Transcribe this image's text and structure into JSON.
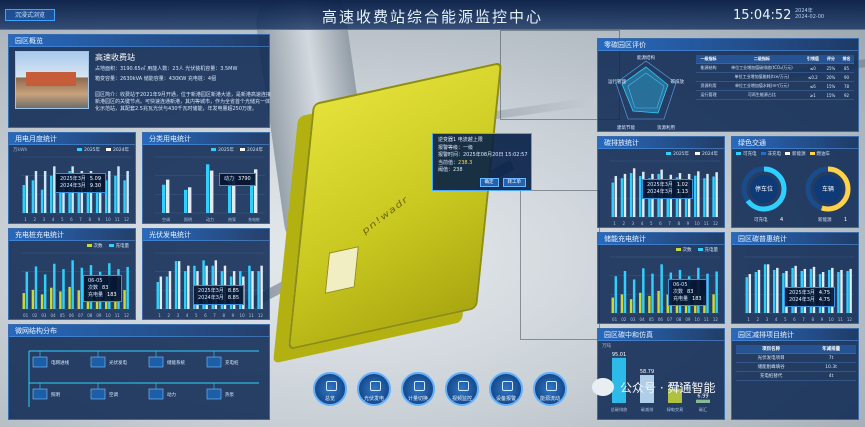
{
  "header": {
    "title": "高速收费站综合能源监控中心",
    "mode_button": "沉浸式浏览",
    "clock": "15:04:52",
    "date_line1": "2024年",
    "date_line2": "2024-02-00"
  },
  "overview": {
    "title": "园区概览",
    "name": "高速收费站",
    "rows": [
      "占地面积：3190.65㎡  用能人数：23人      光伏装机容量：3.5MW",
      "箱变容量：2630kVA  储能容量：430KW      充电桩：4個"
    ],
    "description": "园区简介：收费站于2021年9月开通，位于新港园区新港大道，是新港高速连接新港园区的关键节点。可快速连通新港，其内等城市，作为全省首个光储充一体化示范站，其配套2.5兆瓦光伏与430千瓦时储能，年发电量超250万度。"
  },
  "monthly_power": {
    "title": "用电月度统计",
    "unit": "万kWh",
    "legend": [
      "2025年",
      "2024年"
    ],
    "tooltip": {
      "a_label": "2025年3月",
      "a_val": "5.09",
      "b_label": "2024年3月",
      "b_val": "9.30"
    },
    "chart_data": {
      "type": "bar",
      "categories": [
        "1",
        "2",
        "3",
        "4",
        "5",
        "6",
        "7",
        "8",
        "9",
        "10",
        "11",
        "12"
      ],
      "series": [
        {
          "name": "2025年",
          "values": [
            6,
            7,
            5,
            8,
            6,
            9,
            7,
            8,
            6,
            7,
            8,
            7
          ]
        },
        {
          "name": "2024年",
          "values": [
            8,
            9,
            9,
            10,
            8,
            10,
            9,
            9,
            8,
            9,
            10,
            9
          ]
        }
      ],
      "ylim": [
        0,
        12
      ]
    }
  },
  "category_power": {
    "title": "分类用电统计",
    "legend": [
      "2025年",
      "2024年"
    ],
    "tooltip": {
      "label": "动力",
      "val": "3790"
    },
    "chart_data": {
      "type": "bar",
      "categories": [
        "空调",
        "照明",
        "动力",
        "热泵",
        "充电桩"
      ],
      "series": [
        {
          "name": "2025年",
          "values": [
            2200,
            1800,
            3790,
            2600,
            3000
          ]
        },
        {
          "name": "2024年",
          "values": [
            2600,
            2000,
            3300,
            2900,
            3400
          ]
        }
      ]
    }
  },
  "charger_stats": {
    "title": "充电桩充电统计",
    "legend": [
      "次数",
      "充电量"
    ],
    "tooltip": {
      "title": "06-05",
      "a_label": "次数",
      "a_val": "83",
      "b_label": "充电量",
      "b_val": "183"
    },
    "chart_data": {
      "type": "bar",
      "categories": [
        "01",
        "02",
        "03",
        "04",
        "05",
        "06",
        "07",
        "08",
        "09",
        "10",
        "11",
        "12"
      ],
      "series": [
        {
          "name": "次数",
          "values": [
            60,
            72,
            55,
            80,
            66,
            83,
            70,
            74,
            62,
            78,
            68,
            71
          ]
        },
        {
          "name": "充电量",
          "values": [
            140,
            160,
            130,
            170,
            150,
            183,
            155,
            165,
            140,
            172,
            150,
            158
          ]
        }
      ]
    }
  },
  "pv_stats": {
    "title": "光伏发电统计",
    "tooltip": {
      "a_label": "2025年3月",
      "a_val": "8.85",
      "b_label": "2024年3月",
      "b_val": "8.85"
    },
    "chart_data": {
      "type": "bar",
      "categories": [
        "1",
        "2",
        "3",
        "4",
        "5",
        "6",
        "7",
        "8",
        "9",
        "10",
        "11",
        "12"
      ],
      "series": [
        {
          "name": "2025年",
          "values": [
            5,
            6,
            8.85,
            7,
            8,
            9,
            8,
            7,
            6,
            7,
            8,
            7
          ]
        },
        {
          "name": "2024年",
          "values": [
            6,
            7,
            8.85,
            8,
            7,
            8,
            9,
            8,
            7,
            6,
            7,
            8
          ]
        }
      ]
    }
  },
  "microgrid": {
    "title": "微网结构分布",
    "labels": [
      "电网进线",
      "光伏发电",
      "储能系统",
      "充电桩",
      "照明",
      "空调",
      "动力",
      "热泵"
    ]
  },
  "popup": {
    "line1": "逆变器1 电流越上限",
    "line2": "报警等级：一级",
    "line3": "报警时间：2025年08月20日 15:02:57",
    "line4": "当前值：",
    "value": "238.3",
    "line5": "阈值：238",
    "btn_confirm": "确定",
    "btn_ticket": "转工单"
  },
  "nav": [
    "总览",
    "光伏发电",
    "计量切换",
    "视频监控",
    "设备报警",
    "能源流动"
  ],
  "carbon_eval": {
    "title": "零碳园区评价",
    "radar_labels": [
      "能源结构",
      "碳排放",
      "资源利用",
      "运行管理",
      "建筑节能"
    ],
    "table_headers": [
      "一级指标",
      "二级指标",
      "引领值",
      "评分",
      "排名"
    ],
    "table_rows": [
      [
        "能源结构",
        "单位工业增加值碳排放(tCO₂/万元)",
        "≤0",
        "25%",
        "85"
      ],
      [
        "",
        "单位工业增加值能耗(tce/万元)",
        "≤0.2",
        "20%",
        "90"
      ],
      [
        "资源利用",
        "单位工业增加值水耗(m³/万元)",
        "≤6",
        "15%",
        "78"
      ],
      [
        "运行管理",
        "可再生能源占比",
        "≥1",
        "15%",
        "92"
      ]
    ]
  },
  "carbon_emission": {
    "title": "碳排放统计",
    "legend": [
      "2025年",
      "2024年"
    ],
    "tooltip": {
      "a_label": "2025年3月",
      "a_val": "1.02",
      "b_label": "2024年3月",
      "b_val": "1.13"
    },
    "chart_data": {
      "type": "bar",
      "categories": [
        "1",
        "2",
        "3",
        "4",
        "5",
        "6",
        "7",
        "8",
        "9",
        "10",
        "11",
        "12"
      ],
      "series": [
        {
          "name": "2025年",
          "values": [
            0.8,
            0.9,
            1.02,
            0.95,
            0.9,
            1.0,
            0.85,
            0.92,
            0.88,
            0.96,
            0.9,
            0.94
          ]
        },
        {
          "name": "2024年",
          "values": [
            0.95,
            1.0,
            1.13,
            1.05,
            1.0,
            1.1,
            0.98,
            1.02,
            1.0,
            1.06,
            1.0,
            1.04
          ]
        }
      ]
    }
  },
  "green_transport": {
    "title": "绿色交通",
    "legend": [
      "可充电",
      "非充电",
      "新能源",
      "燃油车"
    ],
    "gauge1_label": "停车位",
    "gauge2_label": "车辆",
    "gauge1_foot": "可充电",
    "gauge1_val": "4",
    "gauge2_foot": "新能源",
    "gauge2_val": "1",
    "gauge1_frac": 0.65,
    "gauge2_frac": 0.55
  },
  "storage_charge": {
    "title": "储能充电统计",
    "legend": [
      "次数",
      "充电量"
    ],
    "tooltip": {
      "title": "06-05",
      "a_label": "次数",
      "a_val": "83",
      "b_label": "充电量",
      "b_val": "183"
    },
    "chart_data": {
      "type": "bar",
      "categories": [
        "01",
        "02",
        "03",
        "04",
        "05",
        "06",
        "07",
        "08",
        "09",
        "10",
        "11",
        "12"
      ],
      "series": [
        {
          "name": "次数",
          "values": [
            58,
            70,
            52,
            76,
            64,
            83,
            69,
            72,
            60,
            75,
            66,
            70
          ]
        },
        {
          "name": "充电量",
          "values": [
            138,
            158,
            126,
            168,
            148,
            183,
            152,
            162,
            138,
            170,
            148,
            156
          ]
        }
      ]
    }
  },
  "carbon_sink": {
    "title": "园区碳普惠统计",
    "tooltip": {
      "a_label": "2025年3月",
      "a_val": "4.75",
      "b_label": "2024年3月",
      "b_val": "4.75"
    },
    "chart_data": {
      "type": "bar",
      "categories": [
        "1",
        "2",
        "3",
        "4",
        "5",
        "6",
        "7",
        "8",
        "9",
        "10",
        "11",
        "12"
      ],
      "series": [
        {
          "name": "2025年",
          "values": [
            3.5,
            4.0,
            4.75,
            4.2,
            3.9,
            4.4,
            4.1,
            4.3,
            3.8,
            4.2,
            4.0,
            4.1
          ]
        },
        {
          "name": "2024年",
          "values": [
            3.8,
            4.2,
            4.75,
            4.4,
            4.1,
            4.6,
            4.3,
            4.5,
            4.0,
            4.4,
            4.2,
            4.3
          ]
        }
      ]
    }
  },
  "carbon_neutral": {
    "title": "园区碳中和仿真",
    "unit": "万吨",
    "chart_data": {
      "type": "bar",
      "categories": [
        "总碳排放",
        "碳减排",
        "绿电交易",
        "碳汇"
      ],
      "values": [
        95.01,
        58.79,
        30.13,
        6.99
      ]
    }
  },
  "reduction_project": {
    "title": "园区减排项目统计",
    "headers": [
      "项目名称",
      "年减排量"
    ],
    "rows": [
      [
        "光伏发电项目",
        "7t"
      ],
      [
        "储能削峰填谷",
        "10.3t"
      ],
      [
        "充电桩替代",
        "4t"
      ]
    ]
  },
  "watermark": {
    "text": "公众号 · 舜通智能"
  },
  "colors": {
    "accent": "#2fb8ff",
    "bar_a": "#2fd0ff",
    "bar_b": "#ffffff",
    "bar_c": "#c9d83a",
    "panel": "#0c2652"
  }
}
